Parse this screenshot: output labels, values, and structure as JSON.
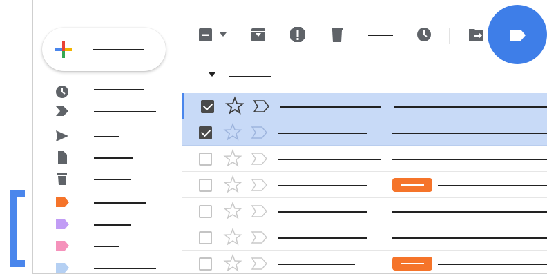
{
  "colors": {
    "accent_blue": "#4a86ec",
    "circle_blue": "#3e7ee8",
    "selected_row": "#c8daf7",
    "icon_gray": "#5f6368",
    "label_orange": "#f5742a",
    "label_purple": "#c19cf5",
    "label_pink": "#f592bb",
    "label_lightblue": "#b5d0f3"
  },
  "compose": {
    "icon": "multicolor-plus-icon"
  },
  "sidebar": {
    "items": [
      {
        "icon": "clock-icon"
      },
      {
        "icon": "label-important-icon"
      },
      {
        "icon": "send-icon"
      },
      {
        "icon": "document-icon"
      },
      {
        "icon": "trash-icon"
      },
      {
        "icon": "label-orange-icon"
      },
      {
        "icon": "label-purple-icon"
      },
      {
        "icon": "label-pink-icon"
      },
      {
        "icon": "label-lightblue-icon"
      }
    ]
  },
  "toolbar": {
    "items": [
      {
        "icon": "select-checkbox-icon"
      },
      {
        "icon": "chevron-down-icon"
      },
      {
        "icon": "archive-icon"
      },
      {
        "icon": "report-spam-icon"
      },
      {
        "icon": "trash-icon"
      },
      {
        "icon": "snooze-clock-icon"
      },
      {
        "icon": "move-to-icon"
      },
      {
        "icon": "label-icon"
      }
    ]
  },
  "list": {
    "rows": [
      {
        "selected": true,
        "checked": true,
        "badge": false
      },
      {
        "selected": true,
        "checked": true,
        "badge": false
      },
      {
        "selected": false,
        "checked": false,
        "badge": false
      },
      {
        "selected": false,
        "checked": false,
        "badge": true
      },
      {
        "selected": false,
        "checked": false,
        "badge": false
      },
      {
        "selected": false,
        "checked": false,
        "badge": false
      },
      {
        "selected": false,
        "checked": false,
        "badge": true
      }
    ]
  }
}
